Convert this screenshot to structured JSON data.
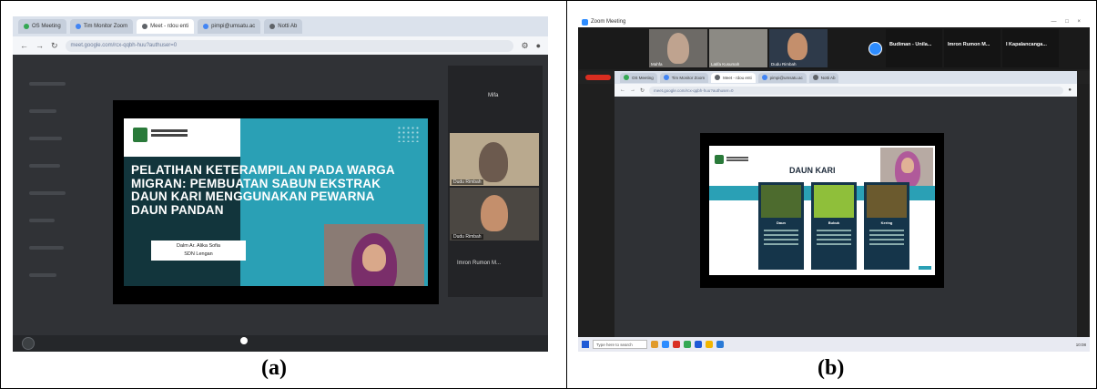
{
  "captions": {
    "a": "(a)",
    "b": "(b)"
  },
  "panel_a": {
    "tabs": [
      {
        "label": "OS Meeting",
        "color": "#34a853"
      },
      {
        "label": "Tim Monitor Zoom",
        "color": "#4285f4"
      },
      {
        "label": "Meet - rdou enti",
        "color": "#5f6368",
        "active": true
      },
      {
        "label": "pimpi@umsatu.ac",
        "color": "#4285f4"
      },
      {
        "label": "Notti Ab",
        "color": "#5f6368"
      }
    ],
    "url": "meet.google.com/rcx-qqbh-huu?authuser=0",
    "slide": {
      "title": "PELATIHAN KETERAMPILAN PADA WARGA MIGRAN: PEMBUATAN SABUN EKSTRAK DAUN KARI MENGGUNAKAN PEWARNA DAUN PANDAN",
      "presenter_line1": "Dalm Ar. Alika Sofia",
      "presenter_line2": "SDN Lengan"
    },
    "sidebar": {
      "top_label": "Mifa",
      "tile_labels": [
        "Mifa",
        "Dudu Rimbah",
        "Dudu Rimbah"
      ],
      "bottom_label": "Imron Rumon M..."
    }
  },
  "panel_b": {
    "window_title": "Zoom Meeting",
    "participants": [
      {
        "name": "Mahfa"
      },
      {
        "name": "Latifa Kusumah"
      },
      {
        "name": "Dudu Rimbah"
      },
      {
        "name": "Budiman - Unila..."
      },
      {
        "name": "Imron Rumon M..."
      },
      {
        "name": "I Kapalancanga..."
      }
    ],
    "sharing_label": "Remote",
    "tabs": [
      {
        "label": "OS Meeting",
        "color": "#34a853"
      },
      {
        "label": "Tim Monitor Zoom",
        "color": "#4285f4"
      },
      {
        "label": "Meet - rdou enti",
        "color": "#5f6368",
        "active": true
      },
      {
        "label": "pimpi@umsatu.ac",
        "color": "#4285f4"
      },
      {
        "label": "Notti Ab",
        "color": "#5f6368"
      }
    ],
    "url": "meet.google.com/rcx-qqbh-huu?authuser=0",
    "slide": {
      "title": "DAUN KARI",
      "cards": [
        "Daun",
        "Bubuk",
        "Kering"
      ]
    },
    "taskbar": {
      "search": "Type here to search",
      "time": "10:08"
    }
  }
}
